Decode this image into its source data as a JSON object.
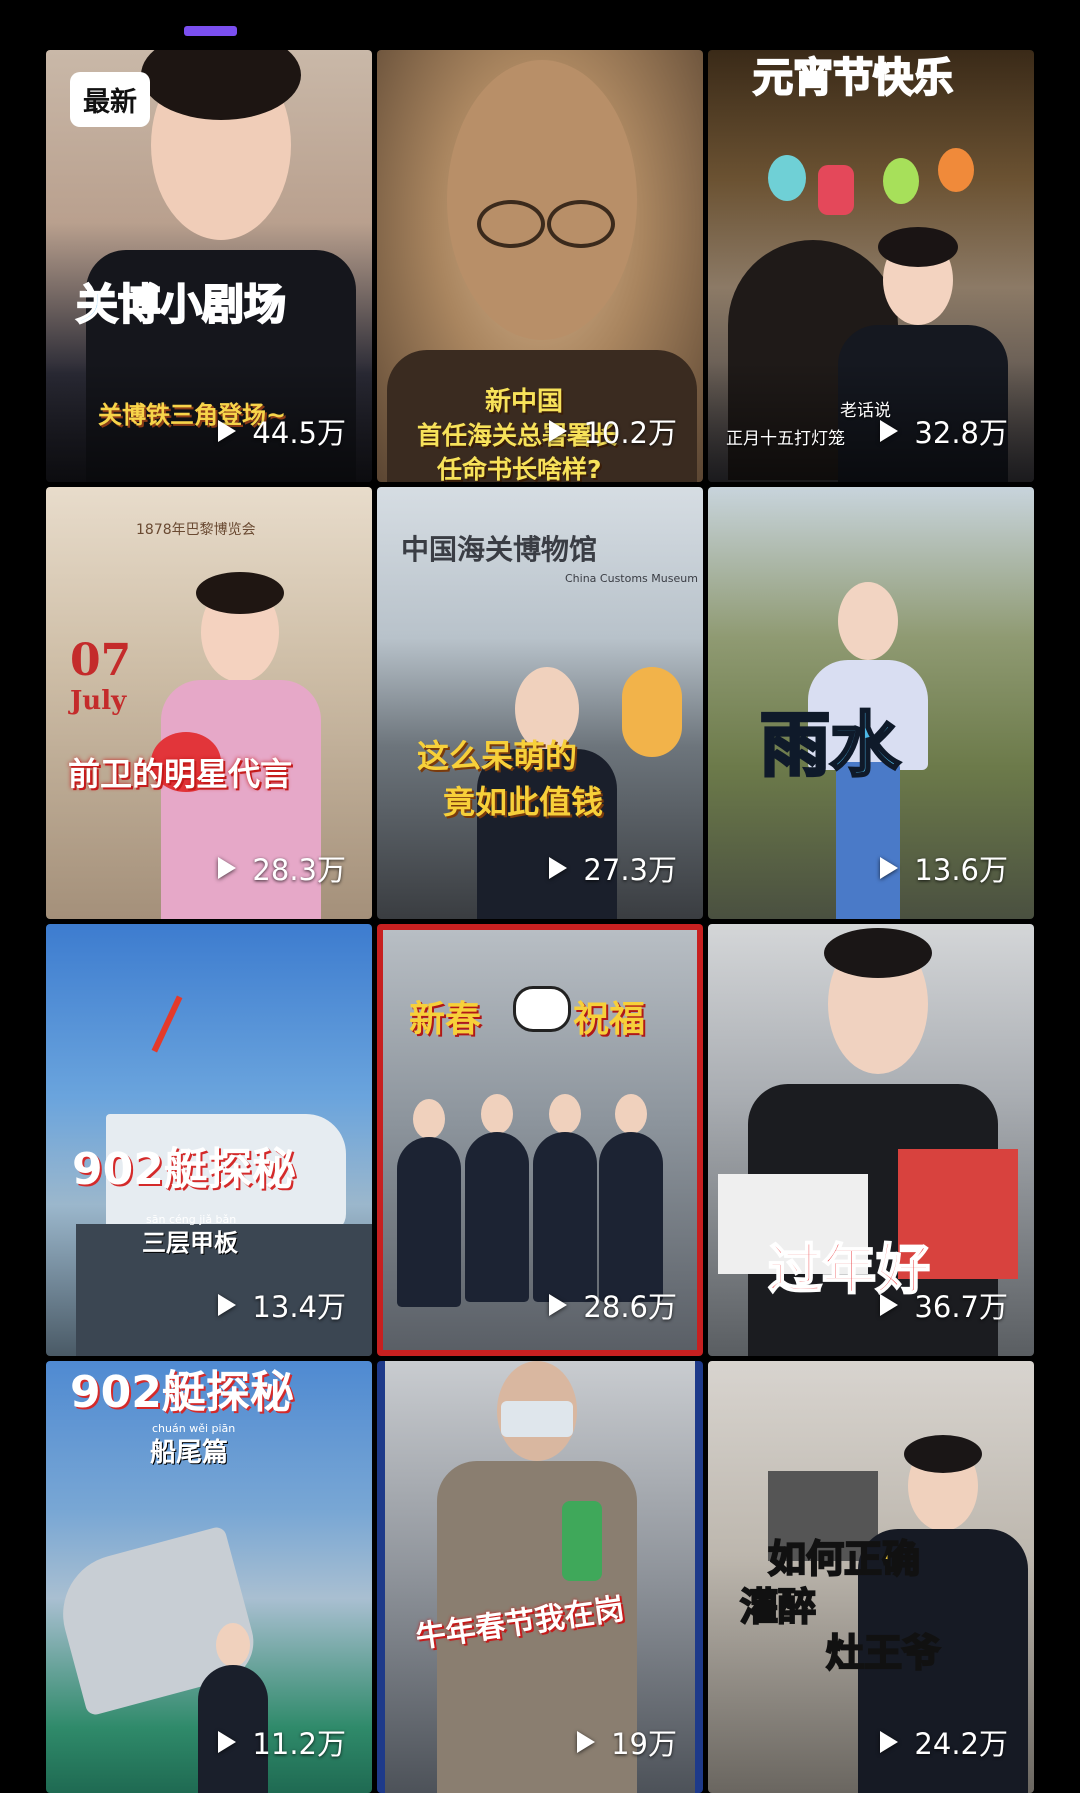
{
  "badge": "最新",
  "colors": {
    "accent": "#7b4ff0",
    "background": "#000000"
  },
  "videos": [
    {
      "caption": "关博小剧场",
      "subcaption": "关博铁三角登场~",
      "plays": "44.5万"
    },
    {
      "caption": "新中国",
      "subcaption": "首任海关总署署长",
      "subcaption2": "任命书长啥样?",
      "plays": "10.2万"
    },
    {
      "caption": "元宵节快乐",
      "subcaption": "老话说",
      "subcaption2": "正月十五打灯笼",
      "plays": "32.8万"
    },
    {
      "caption": "前卫的明星代言",
      "overlay_date": "07",
      "overlay_month": "July",
      "overlay_top": "1878年巴黎博览会",
      "plays": "28.3万"
    },
    {
      "caption": "这么呆萌的",
      "caption2": "竟如此值钱",
      "sign": "中国海关博物馆",
      "sign_en": "China Customs Museum",
      "plays": "27.3万"
    },
    {
      "caption": "雨水",
      "plays": "13.6万"
    },
    {
      "caption": "902艇探秘",
      "subcaption": "三层甲板",
      "pinyin": "sān céng jiǎ bǎn",
      "plays": "13.4万"
    },
    {
      "caption": "新春",
      "caption2": "祝福",
      "plays": "28.6万"
    },
    {
      "caption": "过年好",
      "plays": "36.7万"
    },
    {
      "caption": "902艇探秘",
      "subcaption": "船尾篇",
      "pinyin": "chuán wěi piān",
      "plays": "11.2万"
    },
    {
      "caption": "牛年春节我在岗",
      "plays": "19万"
    },
    {
      "caption": "如何正确",
      "caption2": "灌醉",
      "caption3": "灶王爷",
      "plays": "24.2万"
    }
  ]
}
